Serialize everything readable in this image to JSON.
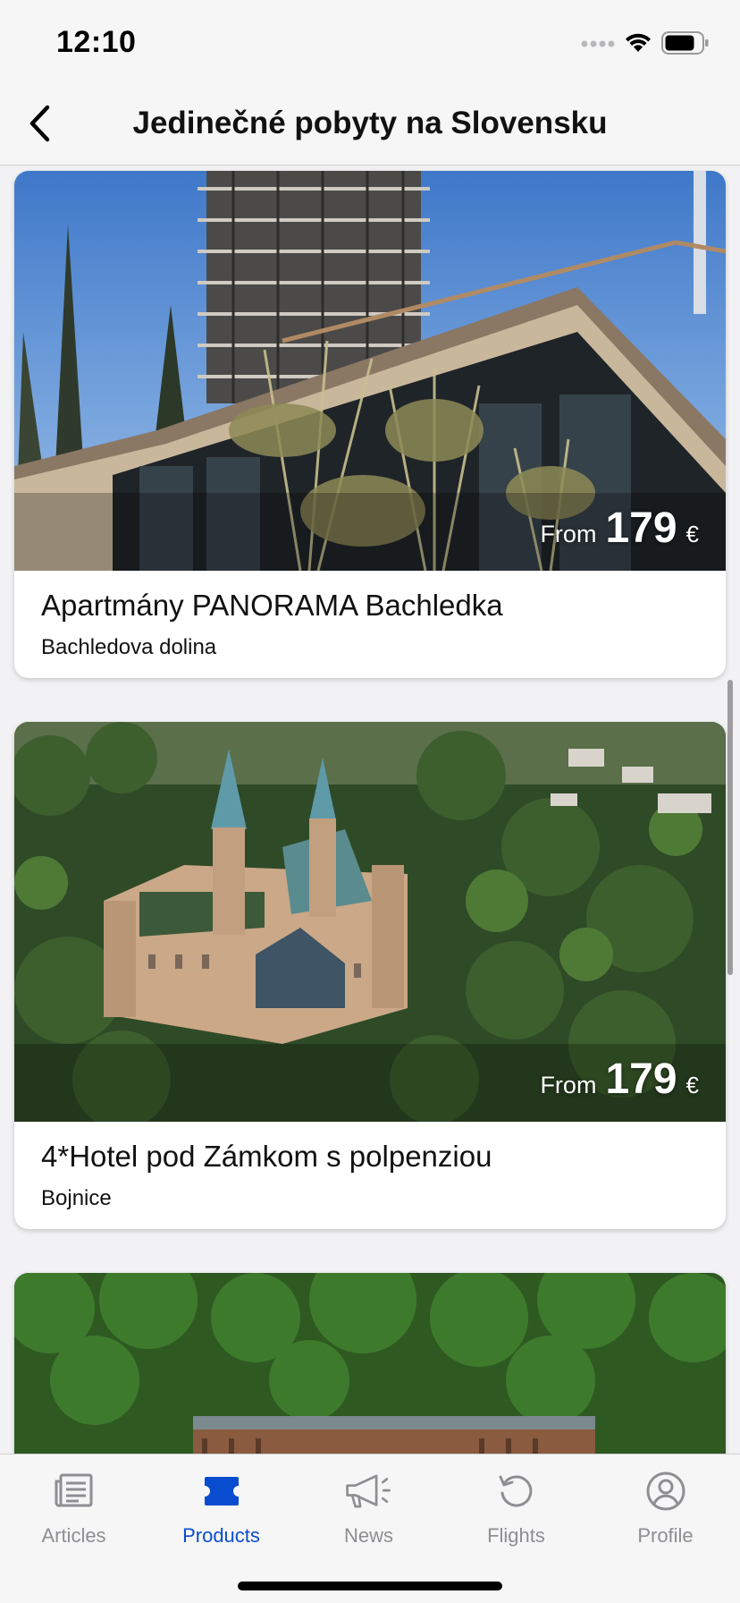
{
  "status_bar": {
    "time": "12:10",
    "icons": [
      "signal-dots-icon",
      "wifi-icon",
      "battery-icon"
    ]
  },
  "nav": {
    "back_icon": "chevron-left-icon",
    "title": "Jedinečné pobyty na Slovensku"
  },
  "cards": [
    {
      "title": "Apartmány PANORAMA Bachledka",
      "location": "Bachledova dolina",
      "price_prefix": "From",
      "price": "179",
      "currency": "€",
      "image": "treetop-walk-tower-photo"
    },
    {
      "title": "4*Hotel pod Zámkom s polpenziou",
      "location": "Bojnice",
      "price_prefix": "From",
      "price": "179",
      "currency": "€",
      "image": "bojnice-castle-aerial-photo"
    },
    {
      "image": "forest-hotel-photo"
    }
  ],
  "tabs": [
    {
      "label": "Articles",
      "icon": "newspaper-icon",
      "active": false
    },
    {
      "label": "Products",
      "icon": "ticket-icon",
      "active": true
    },
    {
      "label": "News",
      "icon": "megaphone-icon",
      "active": false
    },
    {
      "label": "Flights",
      "icon": "refresh-icon",
      "active": false
    },
    {
      "label": "Profile",
      "icon": "user-circle-icon",
      "active": false
    }
  ],
  "colors": {
    "accent": "#0a4ccf",
    "tab_inactive": "#8e8e93",
    "background": "#f2f2f4"
  }
}
